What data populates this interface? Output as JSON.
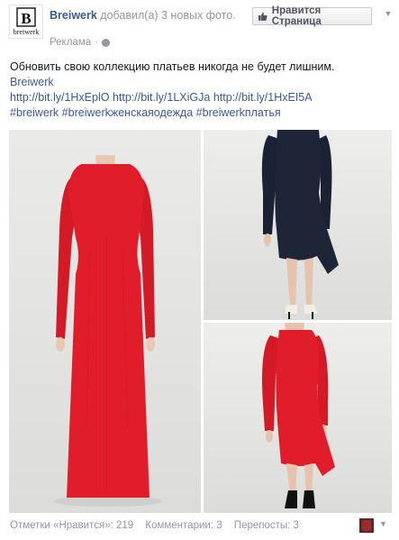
{
  "post": {
    "page_name": "Breiwerk",
    "action_text": "добавил(а) 3 новых фото.",
    "sponsored_label": "Реклама",
    "like_button_label": "Нравится Страница",
    "text": "Обновить свою коллекцию платьев никогда не будет лишним.",
    "brand_link": "Breiwerk",
    "links": [
      "http://bit.ly/1HxEplO",
      "http://bit.ly/1LXiGJa",
      "http://bit.ly/1HxEI5A"
    ],
    "hashtags": [
      "#breiwerk",
      "#breiwerkженскаяодежда",
      "#breiwerkплатья"
    ]
  },
  "logo": {
    "letter": "B",
    "wordmark": "breiwerk"
  },
  "photos": [
    {
      "subject": "red-maxi-dress",
      "color": "#e01c2a"
    },
    {
      "subject": "navy-dress",
      "color": "#1d2536"
    },
    {
      "subject": "red-midi-dress",
      "color": "#e21d2b"
    }
  ],
  "footer": {
    "likes": "Отметки «Нравится»: 219",
    "comments": "Комментарии: 3",
    "shares": "Перепосты: 3"
  },
  "colors": {
    "link": "#3b5998",
    "muted": "#9197a3",
    "text": "#141823"
  }
}
